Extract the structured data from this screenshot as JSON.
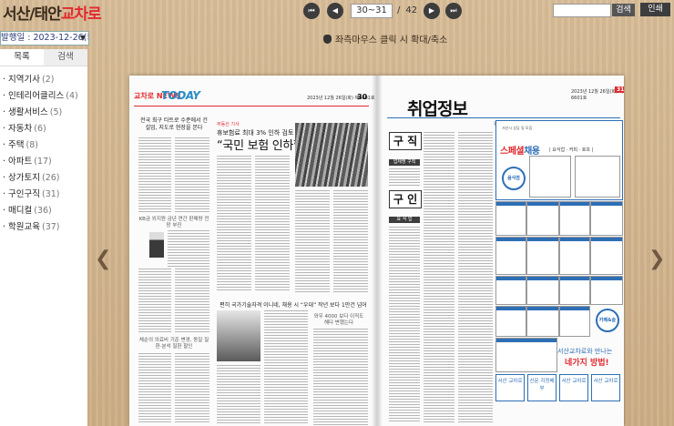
{
  "app": {
    "logo_main": "서산/태안",
    "logo_accent": "교차로"
  },
  "nav": {
    "first_icon": "⏮",
    "prev_icon": "◀",
    "next_icon": "▶",
    "last_icon": "⏭",
    "page_value": "30~31",
    "slash": "/",
    "total_pages": "42"
  },
  "search": {
    "placeholder": "",
    "button_label": "검색",
    "print_label": "인쇄"
  },
  "hint": "좌측마우스 클릭 시 확대/축소",
  "sidebar": {
    "date_label": "발행일 : 2023-12-26(화)",
    "tabs": [
      "목록",
      "검색"
    ],
    "categories": [
      {
        "label": "· 지역기사",
        "count": "(2)"
      },
      {
        "label": "· 인테리어클리스",
        "count": "(4)"
      },
      {
        "label": "· 생활서비스",
        "count": "(5)"
      },
      {
        "label": "· 자동차",
        "count": "(6)"
      },
      {
        "label": "· 주택",
        "count": "(8)"
      },
      {
        "label": "· 아파트",
        "count": "(17)"
      },
      {
        "label": "· 상가토지",
        "count": "(26)"
      },
      {
        "label": "· 구인구직",
        "count": "(31)"
      },
      {
        "label": "· 매디컬",
        "count": "(36)"
      },
      {
        "label": "· 학원교육",
        "count": "(37)"
      }
    ]
  },
  "newspaper": {
    "left": {
      "brand": "교차로 NEWS",
      "section_title": "TODAY",
      "date_line": "2023년 12월 26일(화) 제6601호",
      "page_num": "30",
      "kicker": "전국 최구 타트로 수준에서 건설업, 지도로 현장을 본다",
      "column_head": "KB금 외지원 금년 연간 판매량 전망 부진",
      "label": "부동산 기사",
      "subhead": "휴보험료 최대 3% 인하 검토",
      "headline": "“국민 보험 인하할까”",
      "article2_head": "편히 국가기술자격 이니네, 채용 시 “우대” 작년 보다 1만건 넘어",
      "article3_head": "와우 4000 보다 이직도 해다 변했는다",
      "bottom_left_head": "체순의 의료비 기준 변경, 동일 질환·분석 질환 할인"
    },
    "right": {
      "title": "취업정보",
      "date_line": "2023년 12월 26일(화) 제6601호",
      "page_num": "31",
      "contact": "광고문의 ☎ 662-0000 / 팩스 664-0000",
      "tag_1": "구 직",
      "bar_1": "업체명 구직",
      "tag_2": "구 인",
      "bar_2": "요 식 업",
      "ad_top": "서산시 상담 및 모집",
      "ad_title": "스페셜",
      "ad_title_blue": "채용",
      "ad_sub": "| 요식업 · 커피 · 호프 |",
      "ad_circle_1": "음식점",
      "ad_circle_2": "카페&술",
      "promo_line1": "서산교차로와 만나는",
      "promo_line2": "네가지 방법!",
      "box_1": "서산 교차로",
      "box_2": "신문 지정배부",
      "box_3": "서산 교차로",
      "box_4": "서산 교차로"
    }
  }
}
